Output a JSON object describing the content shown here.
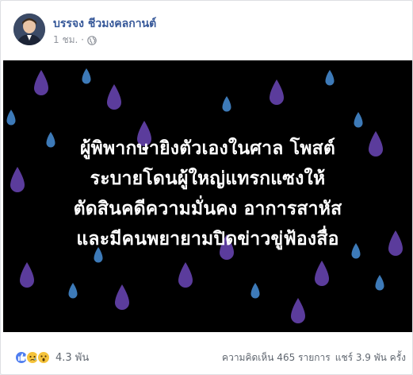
{
  "post": {
    "author": "บรรจง ชีวมงคลกานต์",
    "time": "1 ชม. ·",
    "privacy_icon": "globe-icon"
  },
  "image": {
    "headline_lines": [
      "ผู้พิพากษายิงตัวเองในศาล โพสต์",
      "ระบายโดนผู้ใหญ่แทรกแซงให้",
      "ตัดสินคดีความมั่นคง อาการสาหัส",
      "และมีคนพยายามปิดข่าวขู่ฟ้องสื่อ"
    ],
    "background_color": "#000000",
    "drop_colors": [
      "#5b3c9c",
      "#3d7ab8"
    ]
  },
  "footer": {
    "reaction_icons": [
      "like-icon",
      "sad-icon",
      "wow-icon"
    ],
    "reaction_count": "4.3 พัน",
    "comments": "ความคิดเห็น 465 รายการ",
    "shares": "แชร์ 3.9 พัน ครั้ง"
  }
}
